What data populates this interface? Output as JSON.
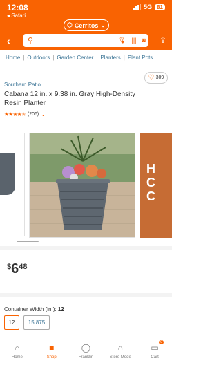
{
  "status_bar": {
    "time": "12:08",
    "back_app": "◂ Safari",
    "network": "5G",
    "battery": "81"
  },
  "header": {
    "store_label": "Cerritos",
    "search_placeholder": ""
  },
  "breadcrumb": [
    "Home",
    "Outdoors",
    "Garden Center",
    "Planters",
    "Plant Pots"
  ],
  "product": {
    "brand": "Southern Patio",
    "title": "Cabana 12 in. x 9.38 in. Gray High-Density Resin Planter",
    "rating_count": "(206)",
    "rating_value": 4.5,
    "favorites": "309",
    "price_symbol": "$",
    "price_dollars": "6",
    "price_cents": "48"
  },
  "carousel": {
    "next_promo_text": "Ho\nC\nC"
  },
  "options": {
    "label": "Container Width (in.):",
    "selected_value": "12",
    "values": [
      "12",
      "15.875"
    ]
  },
  "tabbar": [
    {
      "label": "Home",
      "icon": "home-icon"
    },
    {
      "label": "Shop",
      "icon": "shop-icon"
    },
    {
      "label": "Franklin",
      "icon": "user-icon"
    },
    {
      "label": "Store Mode",
      "icon": "store-icon"
    },
    {
      "label": "Cart",
      "icon": "cart-icon",
      "badge": "0"
    }
  ],
  "colors": {
    "brand_orange": "#f96302",
    "link_blue": "#3e7697"
  }
}
